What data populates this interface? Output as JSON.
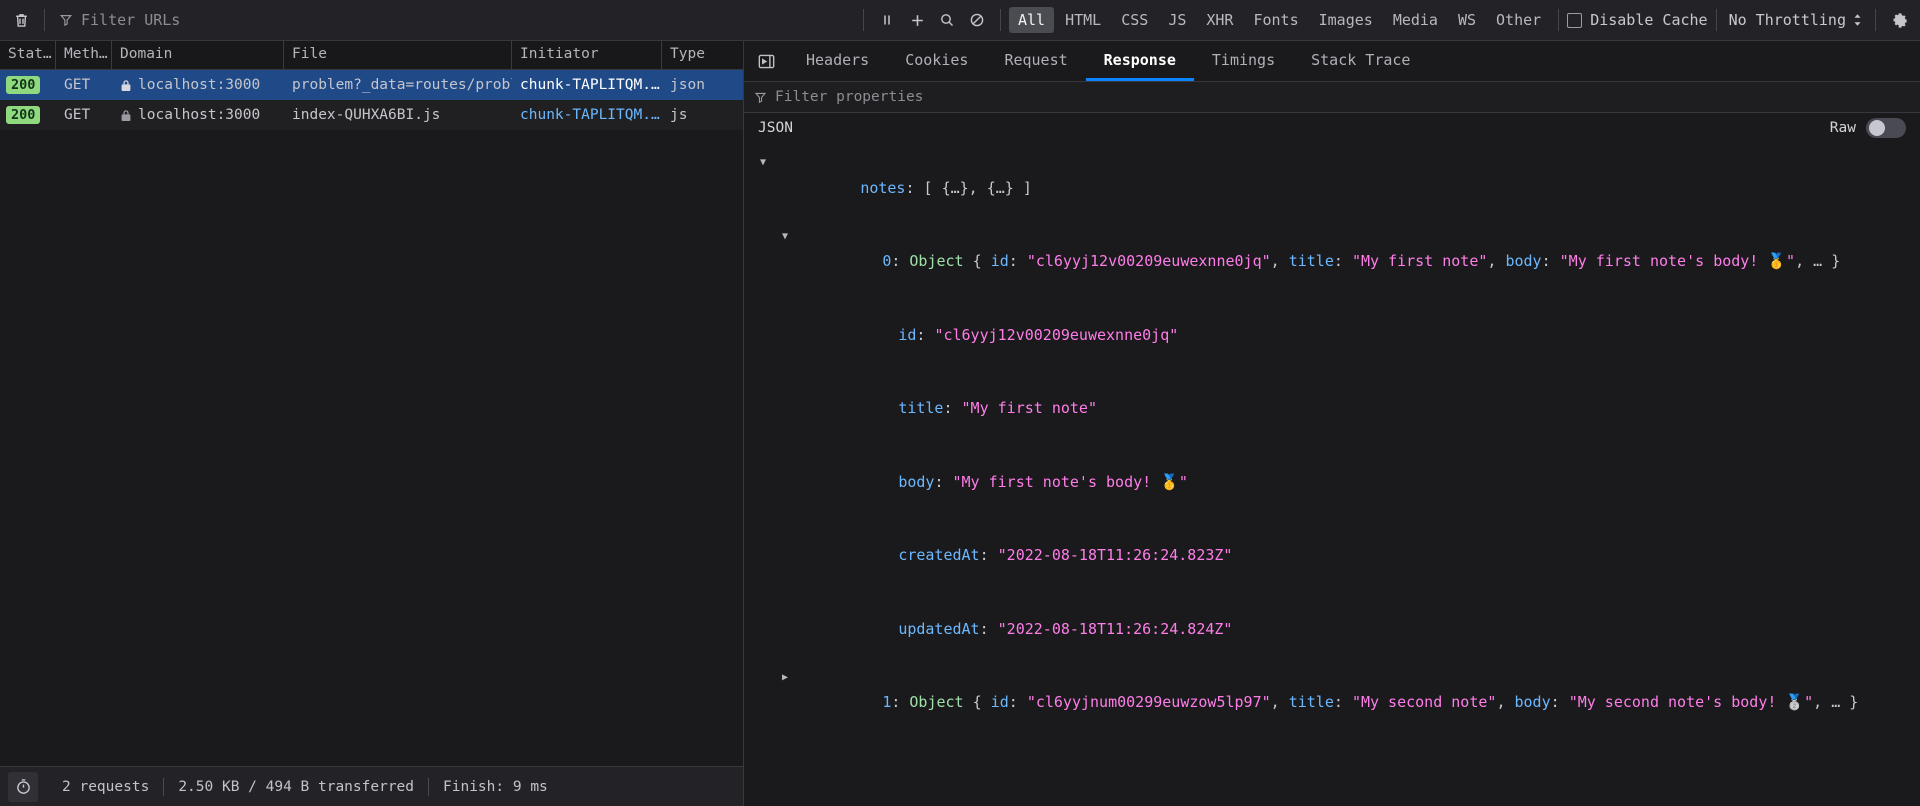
{
  "toolbar": {
    "trash_title": "Clear",
    "filter_placeholder": "Filter URLs",
    "pause_title": "Pause",
    "plus_title": "New Request",
    "search_title": "Search",
    "block_title": "Block",
    "type_filters": [
      {
        "label": "All",
        "active": true
      },
      {
        "label": "HTML",
        "active": false
      },
      {
        "label": "CSS",
        "active": false
      },
      {
        "label": "JS",
        "active": false
      },
      {
        "label": "XHR",
        "active": false
      },
      {
        "label": "Fonts",
        "active": false
      },
      {
        "label": "Images",
        "active": false
      },
      {
        "label": "Media",
        "active": false
      },
      {
        "label": "WS",
        "active": false
      },
      {
        "label": "Other",
        "active": false
      }
    ],
    "disable_cache_label": "Disable Cache",
    "disable_cache_checked": false,
    "throttling_label": "No Throttling"
  },
  "request_table": {
    "columns": [
      "Stat…",
      "Meth…",
      "Domain",
      "File",
      "Initiator",
      "Type"
    ],
    "rows": [
      {
        "status": "200",
        "method": "GET",
        "domain": "localhost:3000",
        "file": "problem?_data=routes/problem",
        "initiator": "chunk-TAPLITQM.…",
        "type": "json",
        "selected": true
      },
      {
        "status": "200",
        "method": "GET",
        "domain": "localhost:3000",
        "file": "index-QUHXA6BI.js",
        "initiator": "chunk-TAPLITQM.…",
        "type": "js",
        "selected": false
      }
    ]
  },
  "statusbar": {
    "requests": "2 requests",
    "transferred": "2.50 KB / 494 B transferred",
    "finish": "Finish: 9 ms"
  },
  "details": {
    "tabs": [
      {
        "label": "Headers",
        "active": false
      },
      {
        "label": "Cookies",
        "active": false
      },
      {
        "label": "Request",
        "active": false
      },
      {
        "label": "Response",
        "active": true
      },
      {
        "label": "Timings",
        "active": false
      },
      {
        "label": "Stack Trace",
        "active": false
      }
    ],
    "filter_placeholder": "Filter properties",
    "json_label": "JSON",
    "raw_label": "Raw",
    "raw_on": false
  },
  "json_tree": {
    "root_key": "notes",
    "root_preview": ": [ {…}, {…} ]",
    "obj0_index": "0",
    "obj0_type": "Object",
    "obj0_preview_line1_a": " { ",
    "obj0_id_key": "id",
    "obj0_id_val": "\"cl6yyj12v00209euwexnne0jq\"",
    "obj0_title_key": "title",
    "obj0_title_val": "\"My first note\"",
    "obj0_body_key": "body",
    "obj0_body_val_head": "\"My first note's",
    "obj0_body_val_tail": "body! 🥇\"",
    "obj0_tail": ", … }",
    "props": [
      {
        "key": "id",
        "value": "\"cl6yyj12v00209euwexnne0jq\""
      },
      {
        "key": "title",
        "value": "\"My first note\""
      },
      {
        "key": "body",
        "value": "\"My first note's body! 🥇\""
      },
      {
        "key": "createdAt",
        "value": "\"2022-08-18T11:26:24.823Z\""
      },
      {
        "key": "updatedAt",
        "value": "\"2022-08-18T11:26:24.824Z\""
      }
    ],
    "obj1_index": "1",
    "obj1_type": "Object",
    "obj1_id_key": "id",
    "obj1_id_val": "\"cl6yyjnum00299euwzow5lp97\"",
    "obj1_title_key": "title",
    "obj1_title_val": "\"My second note\"",
    "obj1_body_key": "body",
    "obj1_body_val_head": "\"My second note's",
    "obj1_body_val_tail": "body! 🥈\"",
    "obj1_tail": ", … }"
  },
  "colors": {
    "accent": "#0a84ff",
    "status_ok": "#8fd97f",
    "selection": "#204a87",
    "key": "#6cb8ff",
    "string": "#ff7de9"
  }
}
